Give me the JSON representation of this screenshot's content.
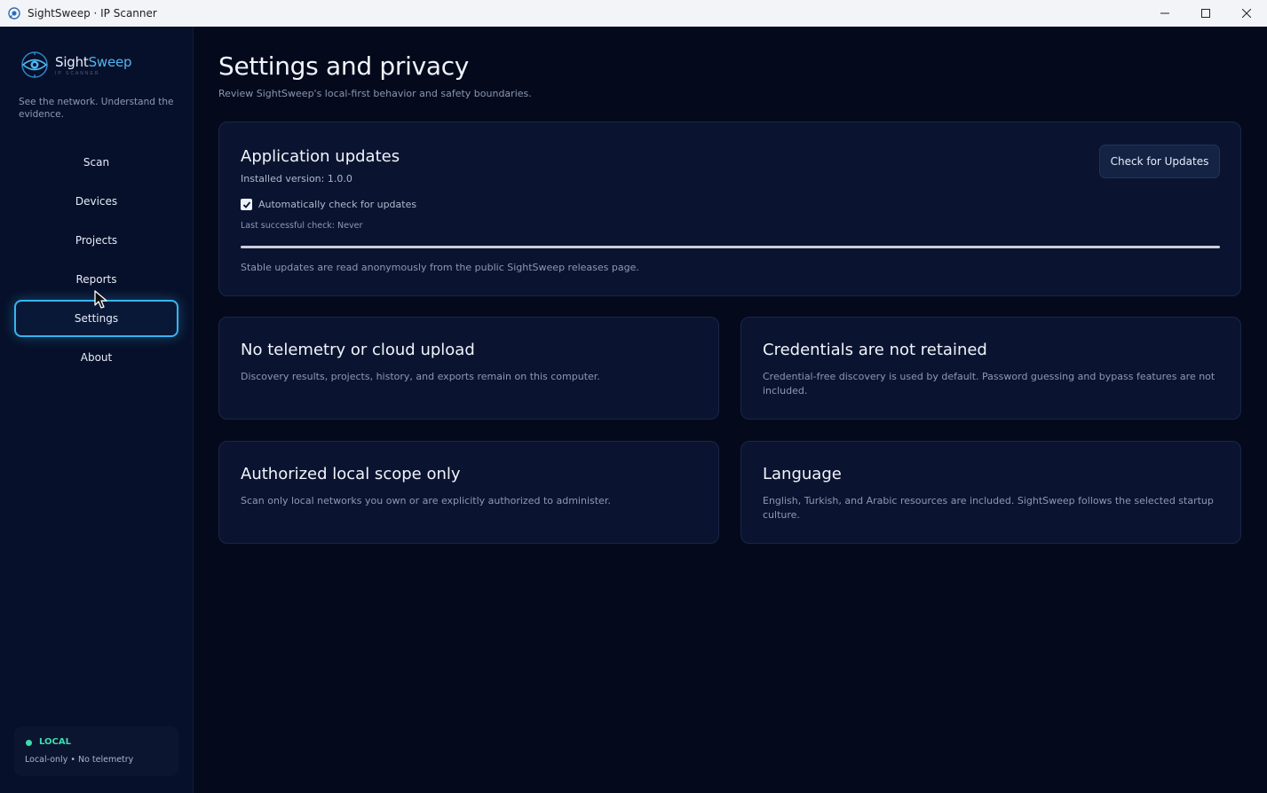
{
  "window": {
    "title": "SightSweep · IP Scanner"
  },
  "sidebar": {
    "brand": {
      "name_part1": "Sight",
      "name_part2": "Sweep",
      "sub": "IP SCANNER"
    },
    "tagline": "See the network. Understand the evidence.",
    "items": [
      {
        "label": "Scan",
        "active": false
      },
      {
        "label": "Devices",
        "active": false
      },
      {
        "label": "Projects",
        "active": false
      },
      {
        "label": "Reports",
        "active": false
      },
      {
        "label": "Settings",
        "active": true
      },
      {
        "label": "About",
        "active": false
      }
    ],
    "status": {
      "label": "LOCAL",
      "sub": "Local-only • No telemetry"
    }
  },
  "main": {
    "title": "Settings and privacy",
    "subtitle": "Review SightSweep's local-first behavior and safety boundaries.",
    "updates": {
      "title": "Application updates",
      "installed": "Installed version: 1.0.0",
      "auto_check_label": "Automatically check for updates",
      "auto_check_checked": true,
      "last_check": "Last successful check: Never",
      "progress_fraction": 1.0,
      "note": "Stable updates are read anonymously from the public SightSweep releases page.",
      "button_label": "Check for Updates"
    },
    "cards": [
      {
        "title": "No telemetry or cloud upload",
        "text": "Discovery results, projects, history, and exports remain on this computer."
      },
      {
        "title": "Credentials are not retained",
        "text": "Credential-free discovery is used by default. Password guessing and bypass features are not included."
      },
      {
        "title": "Authorized local scope only",
        "text": "Scan only local networks you own or are explicitly authorized to administer."
      },
      {
        "title": "Language",
        "text": "English, Turkish, and Arabic resources are included. SightSweep follows the selected startup culture."
      }
    ]
  },
  "colors": {
    "accent": "#36b5ef",
    "status_green": "#3ddbb0",
    "background": "#040a1c",
    "card": "#0a1430"
  },
  "icons": {
    "app": "eye-radar-icon",
    "minimize": "minimize-icon",
    "maximize": "maximize-icon",
    "close": "close-icon"
  }
}
